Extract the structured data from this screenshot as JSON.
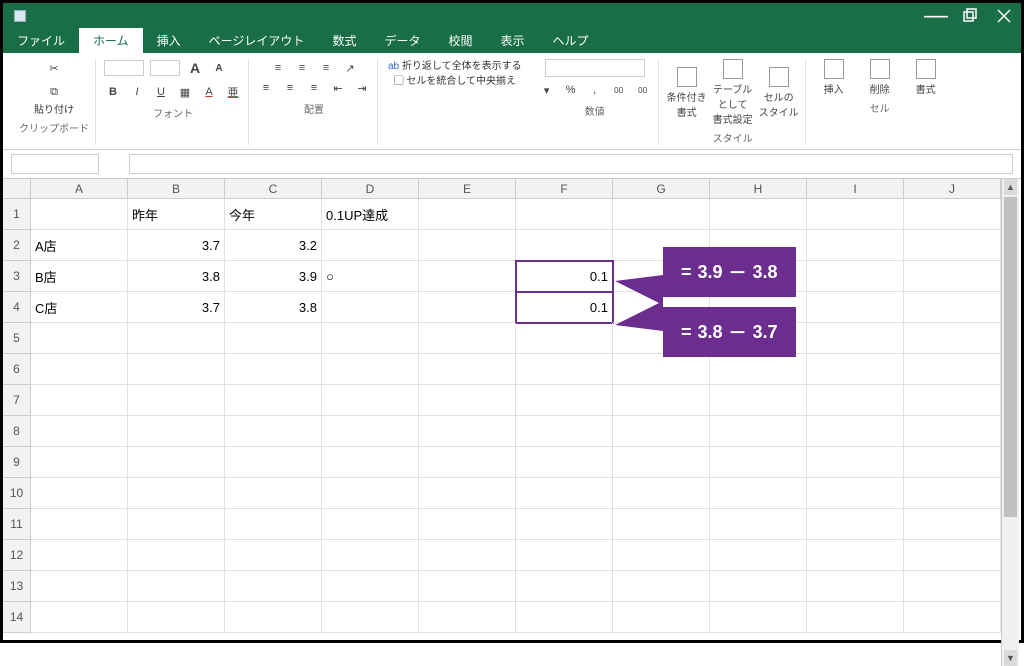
{
  "window": {
    "min": "—",
    "max": "❐",
    "close": "✕"
  },
  "tabs": [
    "ファイル",
    "ホーム",
    "挿入",
    "ページレイアウト",
    "数式",
    "データ",
    "校閲",
    "表示",
    "ヘルプ"
  ],
  "active_tab": "ホーム",
  "ribbon": {
    "clipboard": {
      "paste": "貼り付け",
      "label": "クリップボード"
    },
    "font": {
      "bold": "B",
      "italic": "I",
      "underline": "U",
      "a1": "A",
      "a2": "A",
      "a3": "A",
      "a4": "亜",
      "label": "フォント"
    },
    "align": {
      "wrap": "折り返して全体を表示する",
      "merge": "セルを統合して中央揃え",
      "ab": "ab",
      "label": "配置"
    },
    "number": {
      "pct": "%",
      "comma": ",",
      "d1": "00",
      "d2": "00",
      "label": "数値"
    },
    "styles": {
      "cond": "条件付き\n書式",
      "table": "テーブルとして\n書式設定",
      "cell": "セルの\nスタイル",
      "label": "スタイル"
    },
    "cells": {
      "ins": "挿入",
      "del": "削除",
      "fmt": "書式",
      "label": "セル"
    }
  },
  "columns": [
    "A",
    "B",
    "C",
    "D",
    "E",
    "F",
    "G",
    "H",
    "I",
    "J"
  ],
  "rows": [
    "1",
    "2",
    "3",
    "4",
    "5",
    "6",
    "7",
    "8",
    "9",
    "10",
    "11",
    "12",
    "13",
    "14"
  ],
  "cells": {
    "B1": "昨年",
    "C1": "今年",
    "D1": "0.1UP達成",
    "A2": "A店",
    "B2": "3.7",
    "C2": "3.2",
    "A3": "B店",
    "B3": "3.8",
    "C3": "3.9",
    "D3": "○",
    "A4": "C店",
    "B4": "3.7",
    "C4": "3.8",
    "F3": "0.1",
    "F4": "0.1"
  },
  "callouts": {
    "c1": {
      "eq": "=",
      "a": "3.9",
      "minus": "－",
      "b": "3.8"
    },
    "c2": {
      "eq": "=",
      "a": "3.8",
      "minus": "－",
      "b": "3.7"
    }
  }
}
